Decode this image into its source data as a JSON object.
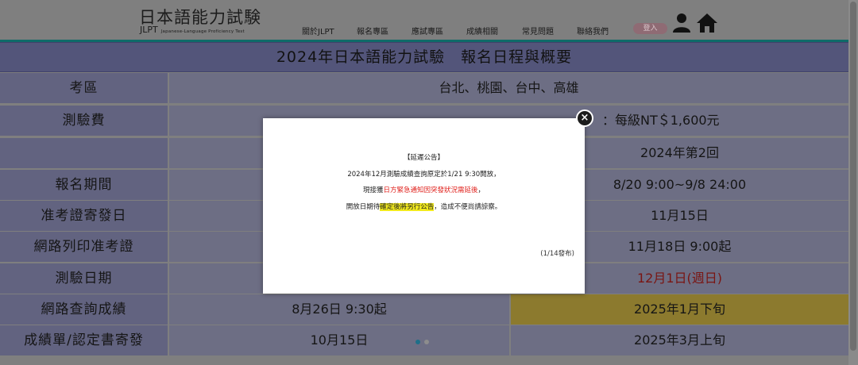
{
  "header": {
    "logo_main": "日本語能力試験",
    "logo_jlpt": "JLPT",
    "logo_sub": "Japanese-Language Proficiency Test",
    "nav": [
      "關於JLPT",
      "報名專區",
      "應試專區",
      "成績相關",
      "常見問題",
      "聯絡我們"
    ],
    "login_label": "登入",
    "icons": [
      "user-icon",
      "home-icon"
    ]
  },
  "page": {
    "title": "2024年日本語能力試驗　報名日程與概要"
  },
  "table": {
    "exam_area_label": "考區",
    "exam_area_value": "台北、桃園、台中、高雄",
    "fee_label": "測驗費",
    "fee_value_visible": "：每級NT＄1,600元",
    "session_2": "2024年第2回",
    "rows": [
      {
        "label": "報名期間",
        "value_2": "8/20 9:00~9/8 24:00"
      },
      {
        "label": "准考證寄發日",
        "value_2": "11月15日"
      },
      {
        "label": "網路列印准考證",
        "value_2": "11月18日 9:00起"
      },
      {
        "label": "測驗日期",
        "value_2": "12月1日(週日)"
      },
      {
        "label": "網路查詢成績",
        "value_1": "8月26日 9:30起",
        "value_2": "2025年1月下旬"
      },
      {
        "label": "成績單/認定書寄發",
        "value_1": "10月15日",
        "value_2": "2025年3月上旬"
      }
    ]
  },
  "modal": {
    "heading": "【延遲公告】",
    "line1": "2024年12月測驗成績查詢原定於1/21 9:30開放，",
    "line2_pre": "現接獲",
    "line2_red": "日方緊急通知因突發狀況需延後",
    "line2_post": "，",
    "line3_pre": "開放日期待",
    "line3_hl": "確定後將另行公告",
    "line3_post": "，造成不便尚請諒察。",
    "note": "(1/14發布)",
    "close_label": "×"
  },
  "colors": {
    "teal_border": "#0f6b68",
    "modal_red": "#e0221d",
    "highlight_yellow": "#f2ea1d",
    "dot_active": "#1e6f89",
    "dot_inactive": "#8d8d8d"
  }
}
